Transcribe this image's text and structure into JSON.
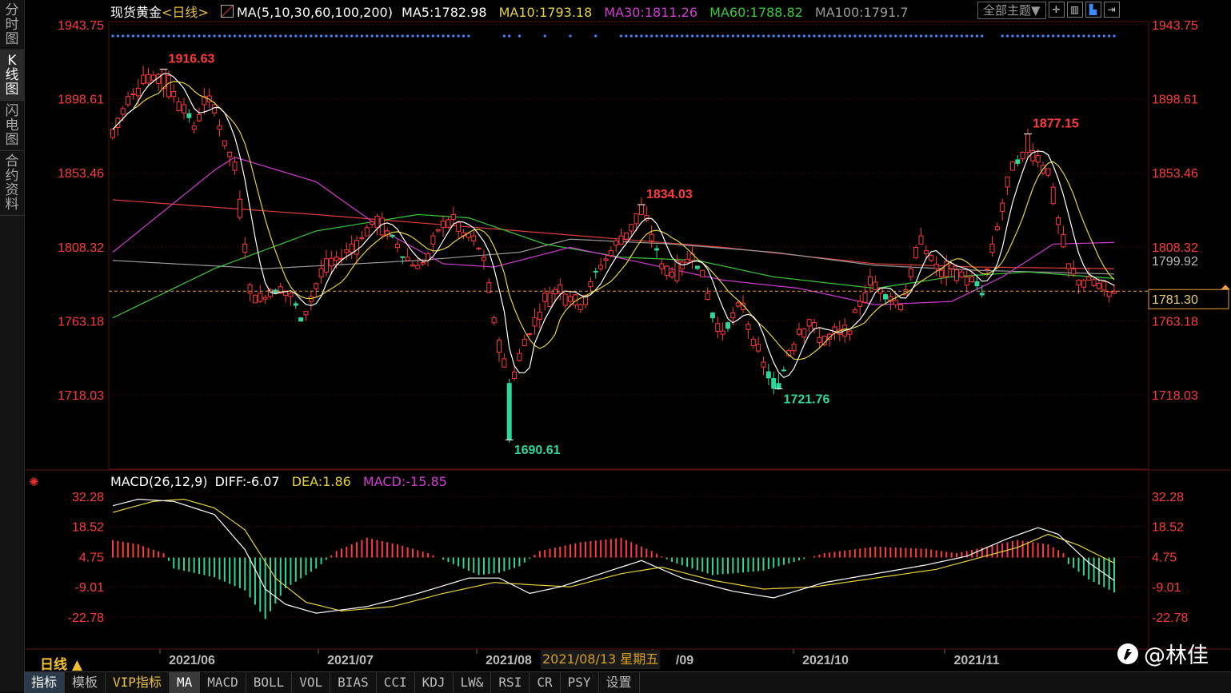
{
  "left_tabs": [
    "分时图",
    "K线图",
    "闪电图",
    "合约资料"
  ],
  "header": {
    "instrument": "现货黄金",
    "period_tag": "<日线>",
    "ma_label": "MA(5,10,30,60,100,200)",
    "ma5": "MA5:1782.98",
    "ma10": "MA10:1793.18",
    "ma30": "MA30:1811.26",
    "ma60": "MA60:1788.82",
    "ma100": "MA100:1791.7",
    "theme_button": "全部主题▼"
  },
  "colors": {
    "up": "#ff3b3b",
    "down": "#2fd69a",
    "ma5": "#ffffff",
    "ma10": "#e6d23c",
    "ma30": "#d23cd2",
    "ma60": "#3cc83c",
    "ma100": "#9a9a9a",
    "ma200": "#e03c3c",
    "price_axis": "#ff3b3b",
    "dots": "#3c8cff"
  },
  "macd_header": {
    "label": "MACD(26,12,9)",
    "diff": "DIFF:-6.07",
    "dea": "DEA:1.86",
    "macd": "MACD:-15.85"
  },
  "bottom_tabs": [
    "指标",
    "模板",
    "VIP指标",
    "MA",
    "MACD",
    "BOLL",
    "VOL",
    "BIAS",
    "CCI",
    "KDJ",
    "LW&",
    "RSI",
    "CR",
    "PSY",
    "设置"
  ],
  "period_label": "日线 ▲",
  "cursor_date": "2021/08/13 星期五",
  "watermark": "@林佳",
  "chart_data": [
    {
      "type": "candlestick",
      "x_ticks": [
        "2021/06",
        "2021/07",
        "2021/08",
        "/09",
        "2021/10",
        "2021/11"
      ],
      "y_ticks": [
        1943.75,
        1898.61,
        1853.46,
        1808.32,
        1763.18,
        1718.03
      ],
      "ylim": [
        1680,
        1950
      ],
      "current_price": 1781.3,
      "reference_price": 1799.92,
      "annotations": [
        {
          "label": "1916.63",
          "index": 10
        },
        {
          "label": "1834.03",
          "index": 104
        },
        {
          "label": "1690.61",
          "index": 78
        },
        {
          "label": "1721.76",
          "index": 131
        },
        {
          "label": "1877.15",
          "index": 180
        }
      ],
      "anchors": [
        [
          0,
          1875,
          1880
        ],
        [
          3,
          1895,
          1900
        ],
        [
          6,
          1908,
          1913
        ],
        [
          8,
          1910,
          1913
        ],
        [
          10,
          1905,
          1916.63
        ],
        [
          12,
          1900,
          1903
        ],
        [
          14,
          1890,
          1895
        ],
        [
          16,
          1880,
          1882
        ],
        [
          18,
          1895,
          1900
        ],
        [
          20,
          1890,
          1895
        ],
        [
          21,
          1880,
          1882
        ],
        [
          22,
          1870,
          1873
        ],
        [
          24,
          1855,
          1860
        ],
        [
          26,
          1805,
          1810
        ],
        [
          27,
          1780,
          1785
        ],
        [
          29,
          1775,
          1780
        ],
        [
          31,
          1778,
          1782
        ],
        [
          33,
          1780,
          1784
        ],
        [
          35,
          1778,
          1780
        ],
        [
          37,
          1765,
          1763
        ],
        [
          39,
          1775,
          1778
        ],
        [
          41,
          1790,
          1795
        ],
        [
          44,
          1800,
          1802
        ],
        [
          47,
          1805,
          1810
        ],
        [
          50,
          1815,
          1820
        ],
        [
          52,
          1820,
          1827
        ],
        [
          54,
          1815,
          1818
        ],
        [
          56,
          1808,
          1810
        ],
        [
          58,
          1800,
          1802
        ],
        [
          60,
          1795,
          1797
        ],
        [
          62,
          1800,
          1804
        ],
        [
          63,
          1810,
          1815
        ],
        [
          65,
          1820,
          1824
        ],
        [
          67,
          1825,
          1828
        ],
        [
          69,
          1815,
          1817
        ],
        [
          71,
          1812,
          1815
        ],
        [
          73,
          1800,
          1802
        ],
        [
          75,
          1762,
          1765
        ],
        [
          77,
          1735,
          1740
        ],
        [
          78,
          1725,
          1690.61
        ],
        [
          79,
          1728,
          1732
        ],
        [
          81,
          1748,
          1752
        ],
        [
          83,
          1760,
          1765
        ],
        [
          85,
          1775,
          1780
        ],
        [
          88,
          1780,
          1785
        ],
        [
          90,
          1775,
          1778
        ],
        [
          92,
          1770,
          1773
        ],
        [
          94,
          1784,
          1787
        ],
        [
          96,
          1795,
          1797
        ],
        [
          98,
          1803,
          1806
        ],
        [
          100,
          1810,
          1815
        ],
        [
          102,
          1818,
          1822
        ],
        [
          104,
          1828,
          1834.03
        ],
        [
          106,
          1812,
          1816
        ],
        [
          108,
          1795,
          1798
        ],
        [
          110,
          1790,
          1793
        ],
        [
          112,
          1795,
          1799
        ],
        [
          114,
          1800,
          1804
        ],
        [
          116,
          1790,
          1794
        ],
        [
          118,
          1768,
          1765
        ],
        [
          120,
          1755,
          1757
        ],
        [
          122,
          1765,
          1768
        ],
        [
          124,
          1770,
          1774
        ],
        [
          126,
          1748,
          1752
        ],
        [
          128,
          1735,
          1738
        ],
        [
          130,
          1728,
          1722
        ],
        [
          131,
          1725,
          1721.76
        ],
        [
          133,
          1742,
          1745
        ],
        [
          135,
          1755,
          1758
        ],
        [
          137,
          1760,
          1764
        ],
        [
          139,
          1750,
          1753
        ],
        [
          141,
          1752,
          1755
        ],
        [
          143,
          1755,
          1758
        ],
        [
          145,
          1755,
          1757
        ],
        [
          147,
          1772,
          1775
        ],
        [
          149,
          1785,
          1790
        ],
        [
          151,
          1780,
          1783
        ],
        [
          153,
          1775,
          1778
        ],
        [
          155,
          1770,
          1773
        ],
        [
          157,
          1790,
          1795
        ],
        [
          159,
          1810,
          1815
        ],
        [
          161,
          1800,
          1803
        ],
        [
          163,
          1790,
          1794
        ],
        [
          165,
          1795,
          1798
        ],
        [
          167,
          1790,
          1793
        ],
        [
          169,
          1787,
          1790
        ],
        [
          171,
          1780,
          1779
        ],
        [
          173,
          1805,
          1810
        ],
        [
          175,
          1830,
          1835
        ],
        [
          177,
          1855,
          1860
        ],
        [
          179,
          1862,
          1866
        ],
        [
          180,
          1866,
          1877.15
        ],
        [
          182,
          1860,
          1864
        ],
        [
          184,
          1852,
          1856
        ],
        [
          186,
          1822,
          1826
        ],
        [
          188,
          1795,
          1798
        ],
        [
          190,
          1785,
          1788
        ],
        [
          192,
          1788,
          1790
        ],
        [
          194,
          1783,
          1786
        ],
        [
          196,
          1778,
          1781
        ],
        [
          197,
          1780,
          1781.3
        ]
      ],
      "ma_series": {
        "ma30": [
          [
            0,
            1805
          ],
          [
            20,
            1855
          ],
          [
            24,
            1863
          ],
          [
            40,
            1848
          ],
          [
            55,
            1815
          ],
          [
            65,
            1798
          ],
          [
            75,
            1796
          ],
          [
            90,
            1808
          ],
          [
            105,
            1798
          ],
          [
            120,
            1788
          ],
          [
            135,
            1783
          ],
          [
            150,
            1773
          ],
          [
            165,
            1775
          ],
          [
            175,
            1790
          ],
          [
            185,
            1810
          ],
          [
            197,
            1811
          ]
        ],
        "ma60": [
          [
            0,
            1765
          ],
          [
            20,
            1795
          ],
          [
            40,
            1818
          ],
          [
            60,
            1828
          ],
          [
            70,
            1826
          ],
          [
            85,
            1810
          ],
          [
            100,
            1802
          ],
          [
            115,
            1800
          ],
          [
            130,
            1790
          ],
          [
            150,
            1783
          ],
          [
            165,
            1790
          ],
          [
            180,
            1793
          ],
          [
            197,
            1789
          ]
        ],
        "ma100": [
          [
            0,
            1800
          ],
          [
            30,
            1795
          ],
          [
            60,
            1800
          ],
          [
            80,
            1805
          ],
          [
            90,
            1813
          ],
          [
            110,
            1810
          ],
          [
            130,
            1805
          ],
          [
            150,
            1797
          ],
          [
            170,
            1794
          ],
          [
            197,
            1791.7
          ]
        ],
        "ma200": [
          [
            0,
            1837
          ],
          [
            40,
            1828
          ],
          [
            80,
            1818
          ],
          [
            120,
            1808
          ],
          [
            150,
            1798
          ],
          [
            170,
            1796
          ],
          [
            197,
            1795
          ]
        ]
      }
    },
    {
      "type": "bar",
      "name": "MACD",
      "y_ticks": [
        32.28,
        18.52,
        4.75,
        -9.01,
        -22.78
      ],
      "ylim": [
        -36,
        37
      ],
      "diff_anchors": [
        [
          0,
          28
        ],
        [
          5,
          31
        ],
        [
          12,
          30
        ],
        [
          20,
          24
        ],
        [
          26,
          8
        ],
        [
          30,
          -10
        ],
        [
          34,
          -17
        ],
        [
          40,
          -21
        ],
        [
          50,
          -18
        ],
        [
          60,
          -12
        ],
        [
          70,
          -5
        ],
        [
          76,
          -5
        ],
        [
          82,
          -12
        ],
        [
          88,
          -9
        ],
        [
          96,
          -3
        ],
        [
          104,
          3
        ],
        [
          112,
          -5
        ],
        [
          122,
          -11
        ],
        [
          130,
          -14
        ],
        [
          140,
          -7
        ],
        [
          150,
          -3
        ],
        [
          160,
          1
        ],
        [
          168,
          5
        ],
        [
          176,
          13
        ],
        [
          182,
          18
        ],
        [
          186,
          15
        ],
        [
          192,
          2
        ],
        [
          197,
          -6.07
        ]
      ],
      "dea_anchors": [
        [
          0,
          25
        ],
        [
          8,
          30
        ],
        [
          14,
          31
        ],
        [
          20,
          27
        ],
        [
          26,
          17
        ],
        [
          32,
          -5
        ],
        [
          38,
          -16
        ],
        [
          45,
          -20
        ],
        [
          55,
          -18
        ],
        [
          65,
          -12
        ],
        [
          75,
          -7
        ],
        [
          82,
          -8
        ],
        [
          90,
          -9
        ],
        [
          100,
          -3
        ],
        [
          108,
          0
        ],
        [
          118,
          -6
        ],
        [
          128,
          -10
        ],
        [
          138,
          -9
        ],
        [
          150,
          -5
        ],
        [
          162,
          -1
        ],
        [
          170,
          4
        ],
        [
          178,
          9
        ],
        [
          184,
          15
        ],
        [
          190,
          10
        ],
        [
          197,
          1.86
        ]
      ],
      "hist_anchors": [
        [
          0,
          8
        ],
        [
          5,
          6
        ],
        [
          10,
          2
        ],
        [
          12,
          -5
        ],
        [
          20,
          -9
        ],
        [
          26,
          -15
        ],
        [
          30,
          -28
        ],
        [
          34,
          -14
        ],
        [
          40,
          -5
        ],
        [
          44,
          3
        ],
        [
          50,
          9
        ],
        [
          56,
          6
        ],
        [
          62,
          2
        ],
        [
          66,
          -2
        ],
        [
          72,
          -8
        ],
        [
          76,
          -7
        ],
        [
          80,
          -4
        ],
        [
          84,
          3
        ],
        [
          92,
          7
        ],
        [
          100,
          9
        ],
        [
          106,
          3
        ],
        [
          110,
          -2
        ],
        [
          118,
          -8
        ],
        [
          128,
          -6
        ],
        [
          134,
          -2
        ],
        [
          140,
          2
        ],
        [
          150,
          5
        ],
        [
          160,
          4
        ],
        [
          166,
          2
        ],
        [
          170,
          4
        ],
        [
          178,
          8
        ],
        [
          184,
          6
        ],
        [
          187,
          2
        ],
        [
          188,
          -3
        ],
        [
          192,
          -10
        ],
        [
          197,
          -15.85
        ]
      ]
    }
  ]
}
